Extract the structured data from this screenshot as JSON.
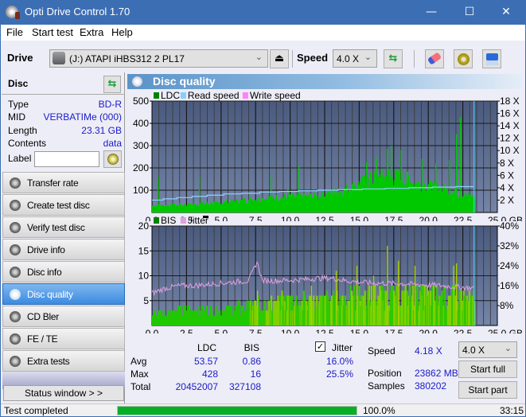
{
  "window": {
    "title": "Opti Drive Control 1.70",
    "minimize": "—",
    "maximize": "☐",
    "close": "✕"
  },
  "menu": [
    "File",
    "Start test",
    "Extra",
    "Help"
  ],
  "toolbar": {
    "drive_label": "Drive",
    "drive_value": "(J:)   ATAPI iHBS312   2 PL17",
    "speed_label": "Speed",
    "speed_value": "4.0 X",
    "eject_icon": "⏏",
    "icons": [
      "eject-icon",
      "refresh-icon",
      "eraser-icon",
      "settings-icon",
      "save-icon"
    ]
  },
  "disc": {
    "header": "Disc",
    "fields": [
      {
        "key": "Type",
        "value": "BD-R"
      },
      {
        "key": "MID",
        "value": "VERBATIMe (000)"
      },
      {
        "key": "Length",
        "value": "23.31 GB"
      },
      {
        "key": "Contents",
        "value": "data"
      }
    ],
    "label_key": "Label",
    "label_value": ""
  },
  "nav": [
    {
      "label": "Transfer rate",
      "active": false
    },
    {
      "label": "Create test disc",
      "active": false
    },
    {
      "label": "Verify test disc",
      "active": false
    },
    {
      "label": "Drive info",
      "active": false
    },
    {
      "label": "Disc info",
      "active": false
    },
    {
      "label": "Disc quality",
      "active": true
    },
    {
      "label": "CD Bler",
      "active": false
    },
    {
      "label": "FE / TE",
      "active": false
    },
    {
      "label": "Extra tests",
      "active": false
    }
  ],
  "status_window_button": "Status window > >",
  "panel_title": "Disc quality",
  "chart_data": [
    {
      "type": "bar",
      "title": "LDC / Read speed",
      "legend": [
        {
          "name": "LDC",
          "color": "#008000"
        },
        {
          "name": "Read speed",
          "color": "#87cefa"
        },
        {
          "name": "Write speed",
          "color": "#ff80ff"
        }
      ],
      "xlabel": "GB",
      "x_ticks": [
        "0.0",
        "2.5",
        "5.0",
        "7.5",
        "10.0",
        "12.5",
        "15.0",
        "17.5",
        "20.0",
        "22.5",
        "25.0 GB"
      ],
      "xlim": [
        0,
        25
      ],
      "y_ticks": [
        "100",
        "200",
        "300",
        "400",
        "500"
      ],
      "ylim": [
        0,
        500
      ],
      "y2_ticks": [
        "2 X",
        "4 X",
        "6 X",
        "8 X",
        "10 X",
        "12 X",
        "14 X",
        "16 X",
        "18 X"
      ],
      "y2lim": [
        0,
        18
      ],
      "ldc_profile": {
        "x": [
          0,
          1,
          2,
          3,
          4,
          5,
          6,
          7,
          8,
          9,
          10,
          11,
          12,
          13,
          14,
          15,
          16,
          17,
          18,
          19,
          20,
          21,
          22,
          23,
          23.31
        ],
        "y": [
          30,
          30,
          32,
          35,
          38,
          42,
          48,
          55,
          60,
          65,
          65,
          68,
          70,
          85,
          100,
          125,
          145,
          160,
          150,
          130,
          115,
          100,
          85,
          70,
          60
        ]
      },
      "ldc_spikes": [
        [
          0.4,
          160
        ],
        [
          3.4,
          160
        ],
        [
          8.6,
          170
        ],
        [
          9.8,
          105
        ],
        [
          10.6,
          210
        ],
        [
          15.5,
          225
        ],
        [
          16.2,
          245
        ],
        [
          17.0,
          285
        ],
        [
          17.3,
          300
        ],
        [
          18.0,
          280
        ],
        [
          19.5,
          240
        ],
        [
          20.5,
          220
        ],
        [
          21.5,
          235
        ],
        [
          22.0,
          350
        ],
        [
          22.3,
          428
        ]
      ],
      "read_speed": {
        "x": [
          0,
          0.8,
          1.8,
          2.9,
          4.0,
          5.2,
          6.5,
          7.8,
          9.2,
          10.6,
          12.0,
          13.5,
          15.2,
          16.9,
          18.6,
          20.3,
          22.0,
          23.31
        ],
        "y": [
          2.0,
          2.2,
          2.4,
          2.6,
          2.8,
          3.0,
          3.1,
          3.3,
          3.4,
          3.5,
          3.6,
          3.7,
          3.8,
          3.9,
          4.0,
          4.1,
          4.18,
          4.18
        ]
      },
      "end_marker_gb": 23.31
    },
    {
      "type": "bar",
      "title": "BIS / Jitter",
      "legend": [
        {
          "name": "BIS",
          "color": "#008000"
        },
        {
          "name": "Jitter",
          "color": "#e0a0e0"
        }
      ],
      "xlabel": "GB",
      "x_ticks": [
        "0.0",
        "2.5",
        "5.0",
        "7.5",
        "10.0",
        "12.5",
        "15.0",
        "17.5",
        "20.0",
        "22.5",
        "25.0 GB"
      ],
      "xlim": [
        0,
        25
      ],
      "y_ticks": [
        "5",
        "10",
        "15",
        "20"
      ],
      "ylim": [
        0,
        20
      ],
      "y2_ticks": [
        "8%",
        "16%",
        "24%",
        "32%",
        "40%"
      ],
      "y2lim": [
        0,
        40
      ],
      "bis_profile": {
        "x": [
          0,
          2.5,
          5,
          7.5,
          10,
          12.5,
          15,
          17.5,
          20,
          22.5,
          23.31
        ],
        "y": [
          2.5,
          3,
          3,
          4,
          5,
          5,
          6,
          6,
          6,
          5.5,
          5
        ]
      },
      "bis_spikes": [
        [
          7.6,
          7
        ],
        [
          11.5,
          8
        ],
        [
          13.3,
          11
        ],
        [
          14.8,
          12
        ],
        [
          16.0,
          10
        ],
        [
          17.0,
          16
        ],
        [
          17.8,
          13
        ],
        [
          19.0,
          12
        ],
        [
          21.8,
          12
        ],
        [
          22.0,
          12.5
        ]
      ],
      "jitter": {
        "x": [
          0,
          1,
          2,
          3,
          4,
          5,
          6,
          7,
          7.6,
          8,
          9,
          10,
          11,
          12,
          13,
          14,
          15,
          16,
          17,
          18,
          19,
          20,
          21,
          22,
          23.31
        ],
        "y": [
          13,
          15,
          16,
          16,
          16.5,
          17,
          17.5,
          18,
          25.5,
          18,
          18,
          18.2,
          18.5,
          19,
          19,
          18,
          17.5,
          17,
          17,
          16.8,
          16.5,
          16.3,
          16,
          15.5,
          15
        ]
      },
      "end_marker_gb": 23.31
    }
  ],
  "stats": {
    "col_ldc": "LDC",
    "col_bis": "BIS",
    "jitter_label": "Jitter",
    "jitter_checked": true,
    "rows": [
      {
        "label": "Avg",
        "ldc": "53.57",
        "bis": "0.86",
        "jitter": "16.0%"
      },
      {
        "label": "Max",
        "ldc": "428",
        "bis": "16",
        "jitter": "25.5%"
      },
      {
        "label": "Total",
        "ldc": "20452007",
        "bis": "327108",
        "jitter": ""
      }
    ],
    "speed_label": "Speed",
    "speed_value": "4.18 X",
    "position_label": "Position",
    "position_value": "23862 MB",
    "samples_label": "Samples",
    "samples_value": "380202",
    "speed_select": "4.0 X",
    "start_full": "Start full",
    "start_part": "Start part"
  },
  "statusbar": {
    "text": "Test completed",
    "progress_percent": 100.0,
    "progress_text": "100.0%",
    "time": "33:15"
  }
}
